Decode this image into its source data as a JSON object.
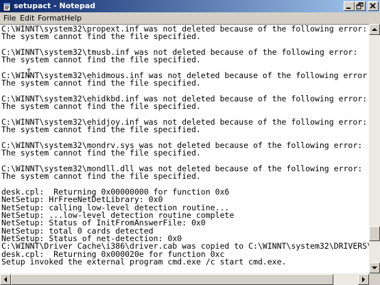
{
  "window": {
    "title": "setupact - Notepad",
    "icon": "notepad-icon",
    "controls": [
      "minimize-icon",
      "maximize-icon",
      "close-icon"
    ],
    "titlebar_colors": [
      "#0a246a",
      "#a6caf0"
    ]
  },
  "menu": {
    "items": [
      {
        "label": "File"
      },
      {
        "label": "Edit"
      },
      {
        "label": "Format"
      },
      {
        "label": "Help"
      }
    ]
  },
  "editor": {
    "lines": [
      "C:\\WINNT\\system32\\propext.inf was not deleted because of the following error:",
      "The system cannot find the file specified.",
      "",
      "C:\\WINNT\\system32\\tmusb.inf was not deleted because of the following error:",
      "The system cannot find the file specified.",
      "",
      "C:\\WINNT\\system32\\ehidmous.inf was not deleted because of the following error",
      "The system cannot find the file specified.",
      "",
      "C:\\WINNT\\system32\\ehidkbd.inf was not deleted because of the following error:",
      "The system cannot find the file specified.",
      "",
      "C:\\WINNT\\system32\\ehidjoy.inf was not deleted because of the following error:",
      "The system cannot find the file specified.",
      "",
      "C:\\WINNT\\system32\\mondrv.sys was not deleted because of the following error:",
      "The system cannot find the file specified.",
      "",
      "C:\\WINNT\\system32\\mondll.dll was not deleted because of the following error:",
      "The system cannot find the file specified.",
      "",
      "desk.cpl:  Returning 0x00000000 for function 0x6",
      "NetSetup: HrFreeNetDetLibrary: 0x0",
      "NetSetup: calling low-level detection routine...",
      "NetSetup: ...low-level detection routine complete",
      "NetSetup: Status of InitFromAnswerFile: 0x0",
      "NetSetup: total 0 cards detected",
      "NetSetup: Status of net-detection: 0x0",
      "C:\\WINNT\\Driver Cache\\i386\\driver.cab was copied to C:\\WINNT\\system32\\DRIVERS\\",
      "desk.cpl:  Returning 0x000020e for function 0xc",
      "Setup invoked the external program cmd.exe /c start cmd.exe."
    ]
  },
  "scrollbars": {
    "vertical_position": 0.9,
    "horizontal_position": 0.0
  }
}
